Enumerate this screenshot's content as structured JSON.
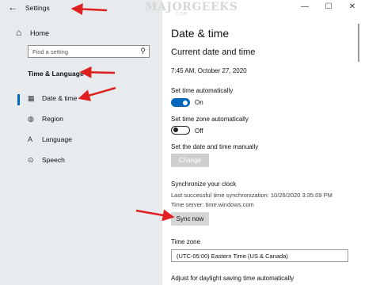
{
  "window": {
    "title": "Settings",
    "back": "←",
    "watermark": "MAJORGEEKS",
    "watermark_sub": ".COM",
    "controls": {
      "minimize": "—",
      "maximize": "☐",
      "close": "✕"
    }
  },
  "sidebar": {
    "home": {
      "label": "Home",
      "icon": "home-icon"
    },
    "search": {
      "placeholder": "Find a setting",
      "icon": "search-icon"
    },
    "section_title": "Time & Language",
    "items": [
      {
        "label": "Date & time",
        "icon": "calendar-clock-icon",
        "selected": true
      },
      {
        "label": "Region",
        "icon": "globe-icon"
      },
      {
        "label": "Language",
        "icon": "language-icon"
      },
      {
        "label": "Speech",
        "icon": "microphone-icon"
      }
    ]
  },
  "main": {
    "title": "Date & time",
    "current_heading": "Current date and time",
    "current_value": "7:45 AM, October 27, 2020",
    "set_time_auto": {
      "label": "Set time automatically",
      "state": "On"
    },
    "set_tz_auto": {
      "label": "Set time zone automatically",
      "state": "Off"
    },
    "manual": {
      "label": "Set the date and time manually",
      "button": "Change"
    },
    "sync": {
      "heading": "Synchronize your clock",
      "last": "Last successful time synchronization: 10/26/2020 3:35:09 PM",
      "server": "Time server: time.windows.com",
      "button": "Sync now"
    },
    "timezone": {
      "label": "Time zone",
      "value": "(UTC-05:00) Eastern Time (US & Canada)"
    },
    "dst_label": "Adjust for daylight saving time automatically"
  },
  "colors": {
    "accent": "#0067c0",
    "annotation_arrow": "#e02020",
    "sidebar_bg": "#e7ebee"
  }
}
